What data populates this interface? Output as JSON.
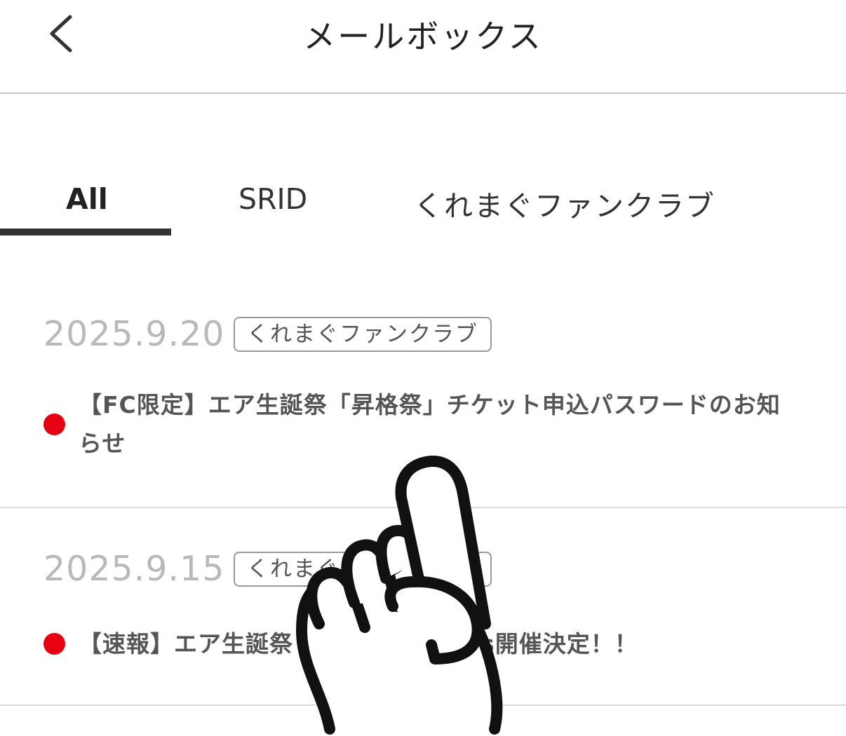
{
  "header": {
    "title": "メールボックス",
    "back_icon": "chevron-left-icon"
  },
  "tabs": [
    {
      "label": "All",
      "active": true
    },
    {
      "label": "SRID",
      "active": false
    },
    {
      "label": "くれまぐファンクラブ",
      "active": false
    }
  ],
  "mails": [
    {
      "date": "2025.9.20",
      "tag": "くれまぐファンクラブ",
      "unread": true,
      "subject": "【FC限定】エア生誕祭「昇格祭」チケット申込パスワードのお知らせ"
    },
    {
      "date": "2025.9.15",
      "tag": "くれまぐファンクラブ",
      "unread": true,
      "subject": "【速報】エア生誕祭「昇格祭」2Days開催決定！！"
    }
  ],
  "colors": {
    "unread_dot": "#e60012",
    "tab_indicator": "#333333",
    "date_text": "#b9b9b9"
  },
  "overlay": {
    "icon": "pointing-hand-icon"
  }
}
